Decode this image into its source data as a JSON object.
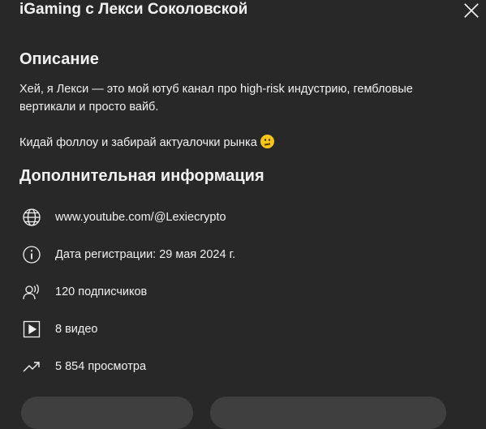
{
  "dialog": {
    "title": "iGaming с Лекси Соколовской",
    "close_icon": "close-icon"
  },
  "description": {
    "heading": "Описание",
    "paragraph1": "Хей, я Лекси — это мой ютуб канал про high-risk индустрию, гембловые вертикали и просто вайб.",
    "paragraph2": "Кидай фоллоу и забирай актуалочки рынка",
    "emoji": "neutral-face-emoji"
  },
  "info": {
    "heading": "Дополнительная информация",
    "items": [
      {
        "icon": "globe-icon",
        "text": "www.youtube.com/@Lexiecrypto"
      },
      {
        "icon": "info-icon",
        "text": "Дата регистрации: 29 мая 2024 г."
      },
      {
        "icon": "subscribers-icon",
        "text": "120 подписчиков"
      },
      {
        "icon": "video-icon",
        "text": "8 видео"
      },
      {
        "icon": "trending-icon",
        "text": "5 854 просмотра"
      }
    ]
  },
  "colors": {
    "background": "#282828",
    "text": "#f1f1f1",
    "button": "#3f3f3f"
  }
}
